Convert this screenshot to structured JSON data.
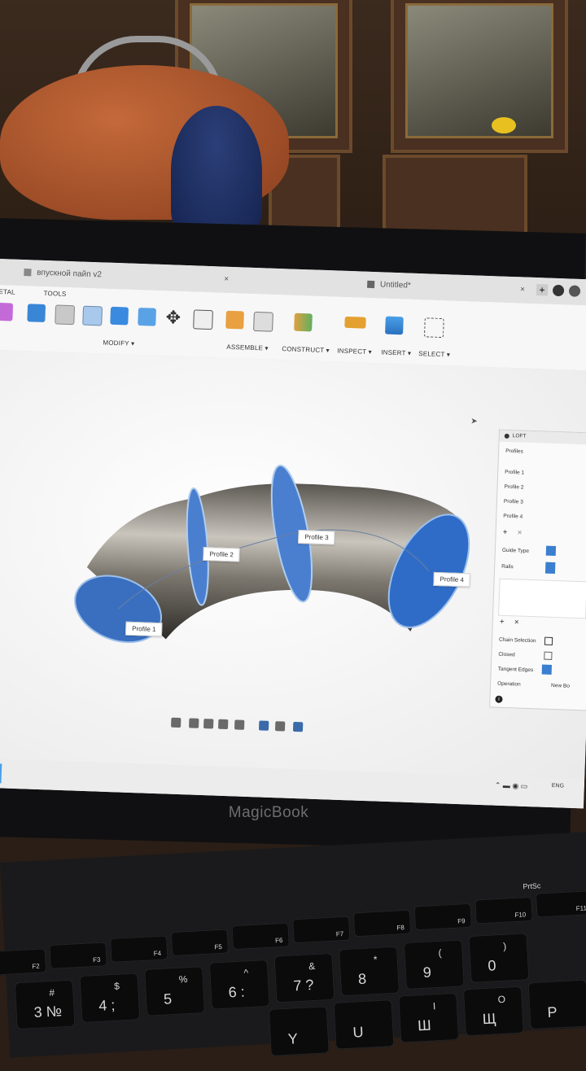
{
  "app": {
    "tabs": [
      {
        "label": "впускной пайп v2",
        "close": "×"
      },
      {
        "label": "Untitled*",
        "close": "×"
      }
    ],
    "toolbar": {
      "sections": [
        "ETAL",
        "TOOLS"
      ],
      "groups": [
        "MODIFY ▾",
        "ASSEMBLE ▾",
        "CONSTRUCT ▾",
        "INSPECT ▾",
        "INSERT ▾",
        "SELECT ▾"
      ]
    },
    "viewport": {
      "profile_labels": [
        "Profile 1",
        "Profile 2",
        "Profile 3",
        "Profile 4"
      ]
    },
    "loft_panel": {
      "title": "LOFT",
      "profiles_header": "Profiles",
      "profiles": [
        "Profile 1",
        "Profile 2",
        "Profile 3",
        "Profile 4"
      ],
      "add": "+",
      "remove": "×",
      "guide_type": "Guide Type",
      "rails": "Rails",
      "chain_selection": "Chain Selection",
      "closed": "Closed",
      "tangent_edges": "Tangent Edges",
      "operation": "Operation",
      "operation_value": "New Bo",
      "info": "i"
    },
    "taskbar": {
      "tray_text": "ENG"
    }
  },
  "laptop": {
    "brand": "MagicBook",
    "fkeys": [
      "F2",
      "F3",
      "F4",
      "F5",
      "F6",
      "F7",
      "F8",
      "F9",
      "F10",
      "F11"
    ],
    "prtsc": "PrtSc",
    "keys": [
      {
        "main": "3 №",
        "sub": "#"
      },
      {
        "main": "4 ;",
        "sub": "$"
      },
      {
        "main": "5",
        "sub": "%"
      },
      {
        "main": "6 :",
        "sub": "^"
      },
      {
        "main": "7 ?",
        "sub": "&"
      },
      {
        "main": "8",
        "sub": "*"
      },
      {
        "main": "9",
        "sub": "("
      },
      {
        "main": "0",
        "sub": ")"
      },
      {
        "main": "Щ",
        "sub": "O"
      },
      {
        "main": "Ш",
        "sub": "I"
      },
      {
        "main": "Y",
        "sub": ""
      },
      {
        "main": "U",
        "sub": ""
      },
      {
        "main": "P",
        "sub": ""
      }
    ]
  }
}
